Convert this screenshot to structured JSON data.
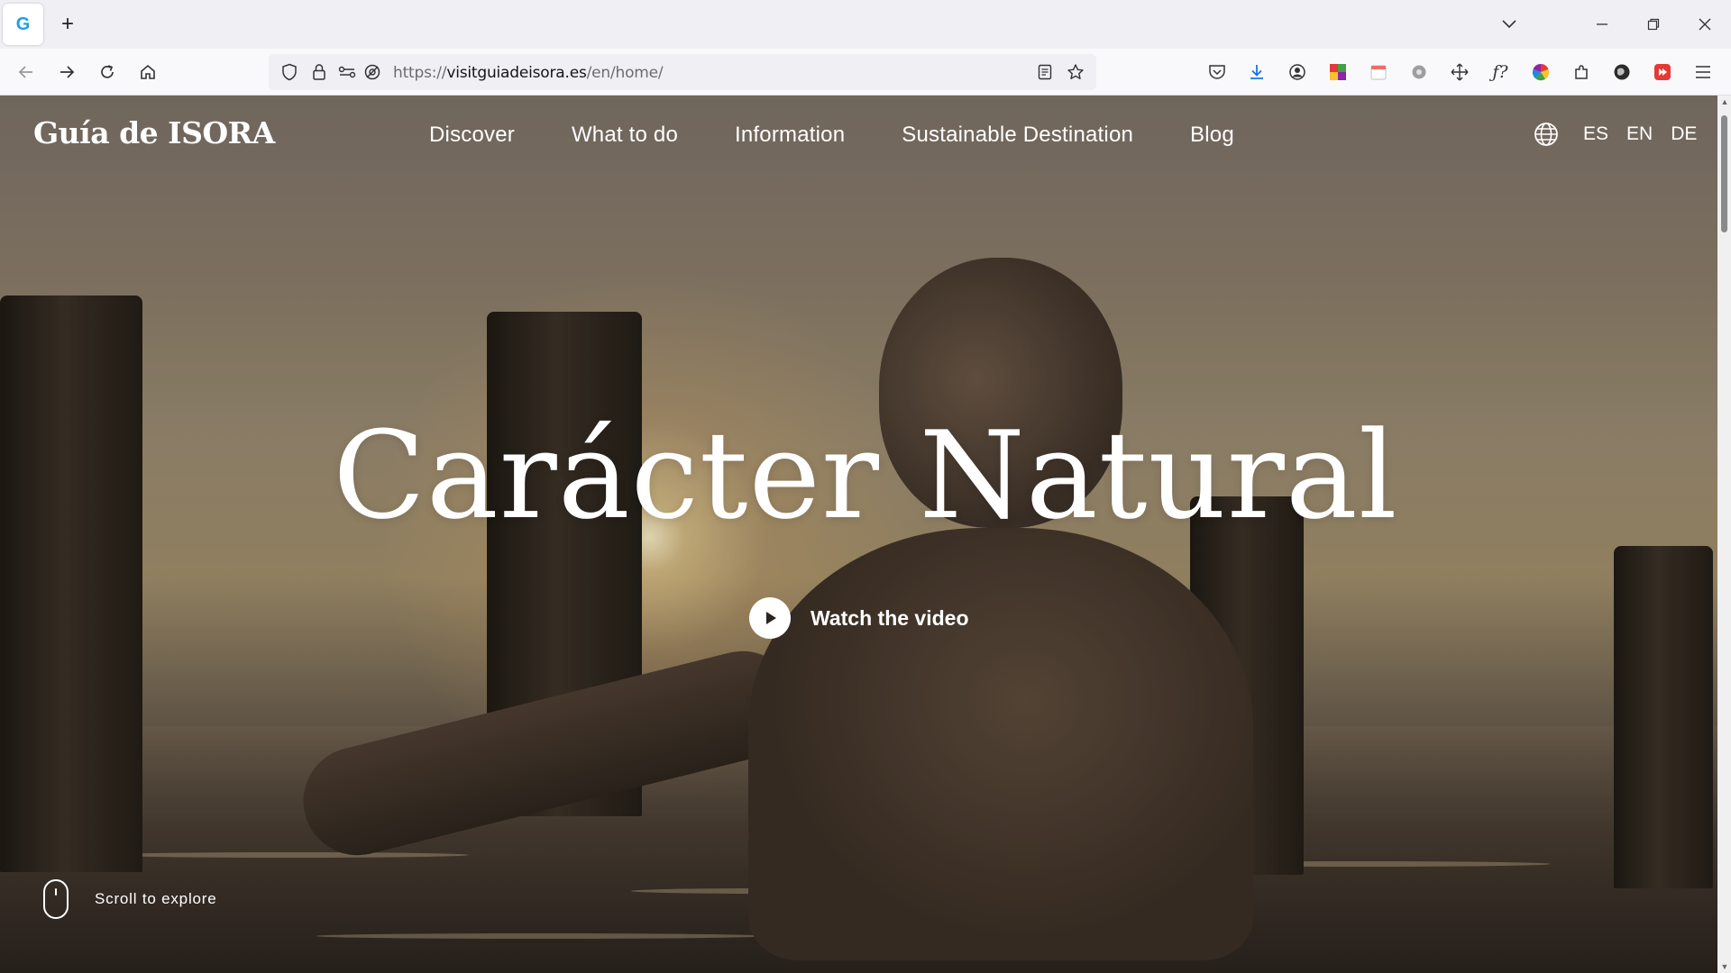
{
  "browser": {
    "tab": {
      "favicon_letter": "G"
    },
    "newtab_symbol": "+",
    "url": {
      "prefix": "https://",
      "domain": "visitguiadeisora.es",
      "path": "/en/home/"
    }
  },
  "site": {
    "logo": "Guía de ISORA",
    "nav": [
      {
        "label": "Discover"
      },
      {
        "label": "What to do"
      },
      {
        "label": "Information"
      },
      {
        "label": "Sustainable Destination"
      },
      {
        "label": "Blog"
      }
    ],
    "languages": [
      "ES",
      "EN",
      "DE"
    ]
  },
  "hero": {
    "title": "Carácter Natural",
    "video_label": "Watch the video",
    "scroll_label": "Scroll to explore"
  },
  "colors": {
    "accent": "#1ba1e2",
    "text_on_hero": "#ffffff"
  }
}
